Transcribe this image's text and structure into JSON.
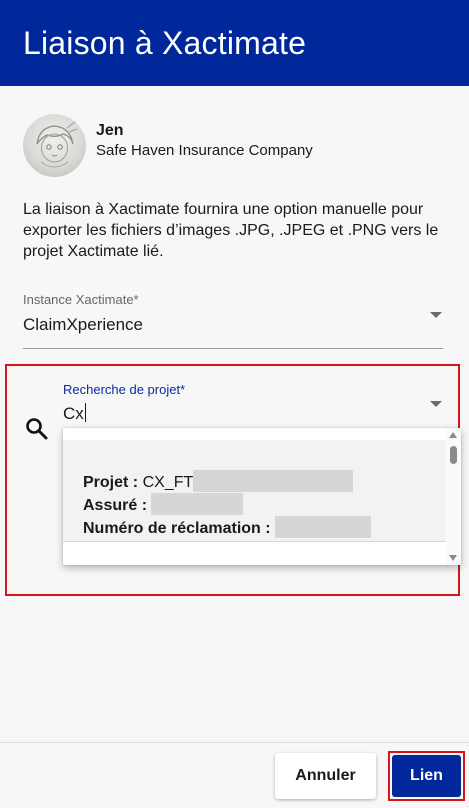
{
  "header": {
    "title": "Liaison à Xactimate"
  },
  "user": {
    "name": "Jen",
    "company": "Safe Haven Insurance Company"
  },
  "description": "La liaison à Xactimate fournira une option manuelle pour exporter les fichiers d’images .JPG, .JPEG et .PNG vers le projet Xactimate lié.",
  "instance_field": {
    "label": "Instance Xactimate*",
    "value": "ClaimXperience"
  },
  "project_search": {
    "label": "Recherche de projet*",
    "value": "Cx",
    "results": [
      {
        "project_label": "Projet :",
        "project_value": "CX_FT",
        "insured_label": "Assuré :",
        "claim_label": "Numéro de réclamation :"
      }
    ]
  },
  "footer": {
    "cancel_label": "Annuler",
    "link_label": "Lien"
  },
  "colors": {
    "brand": "#00289a",
    "highlight": "#d3161b"
  }
}
